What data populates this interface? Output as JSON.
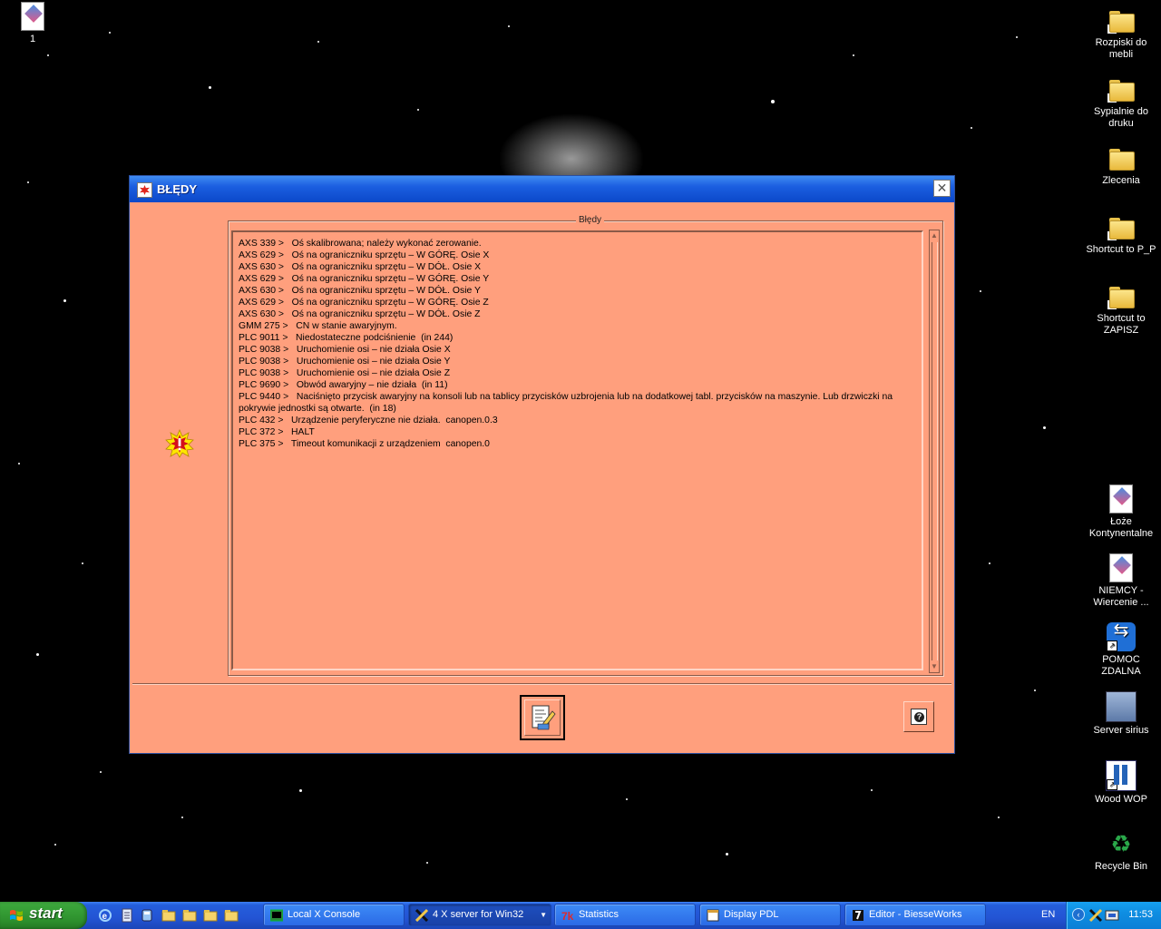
{
  "desktop": {
    "icons_left": [
      {
        "label": "1",
        "icon": "paint-document-icon"
      }
    ],
    "icons_right": [
      {
        "label": "Rozpiski do mebli",
        "icon": "folder-shortcut-icon"
      },
      {
        "label": "Sypialnie do druku",
        "icon": "folder-shortcut-icon"
      },
      {
        "label": "Zlecenia",
        "icon": "folder-icon"
      },
      {
        "label": "Shortcut to P_P",
        "icon": "folder-shortcut-icon"
      },
      {
        "label": "Shortcut to ZAPISZ",
        "icon": "folder-shortcut-icon"
      },
      {
        "label": "Łoże Kontynentalne",
        "icon": "paint-document-icon"
      },
      {
        "label": "NIEMCY - Wiercenie ...",
        "icon": "paint-document-icon"
      },
      {
        "label": "POMOC ZDALNA",
        "icon": "teamviewer-icon"
      },
      {
        "label": "Server sirius",
        "icon": "server-icon"
      },
      {
        "label": "Wood WOP",
        "icon": "wood-wop-icon"
      },
      {
        "label": "Recycle Bin",
        "icon": "recycle-bin-icon"
      }
    ]
  },
  "dialog": {
    "title": "BŁĘDY",
    "close_label": "✕",
    "group_label": "Błędy",
    "errors": [
      "AXS 339 >   Oś skalibrowana; należy wykonać zerowanie.",
      "AXS 629 >   Oś na ograniczniku sprzętu – W GÓRĘ. Osie X",
      "AXS 630 >   Oś na ograniczniku sprzętu – W DÓŁ. Osie X",
      "AXS 629 >   Oś na ograniczniku sprzętu – W GÓRĘ. Osie Y",
      "AXS 630 >   Oś na ograniczniku sprzętu – W DÓŁ. Osie Y",
      "AXS 629 >   Oś na ograniczniku sprzętu – W GÓRĘ. Osie Z",
      "AXS 630 >   Oś na ograniczniku sprzętu – W DÓŁ. Osie Z",
      "GMM 275 >   CN w stanie awaryjnym.",
      "PLC 9011 >   Niedostateczne podciśnienie  (in 244)",
      "PLC 9038 >   Uruchomienie osi – nie działa Osie X",
      "PLC 9038 >   Uruchomienie osi – nie działa Osie Y",
      "PLC 9038 >   Uruchomienie osi – nie działa Osie Z",
      "PLC 9690 >   Obwód awaryjny – nie działa  (in 11)",
      "PLC 9440 >   Naciśnięto przycisk awaryjny na konsoli lub na tablicy przycisków uzbrojenia lub na dodatkowej tabl. przycisków na maszynie. Lub drzwiczki na pokrywie jednostki są otwarte.  (in 18)",
      "PLC 432 >   Urządzenie peryferyczne nie działa.  canopen.0.3",
      "PLC 372 >   HALT",
      "PLC 375 >   Timeout komunikacji z urządzeniem  canopen.0"
    ]
  },
  "taskbar": {
    "start_label": "start",
    "quick_launch": [
      "ie-icon",
      "notepad-icon",
      "tool-icon",
      "folder-icon",
      "folder-icon",
      "folder-icon",
      "folder-icon"
    ],
    "tasks": [
      {
        "label": "Local X Console",
        "icon": "console-icon",
        "active": false
      },
      {
        "label": "4 X server for Win32",
        "icon": "x-server-icon",
        "active": true
      },
      {
        "label": "Statistics",
        "icon": "tk-icon",
        "active": false
      },
      {
        "label": "Display PDL",
        "icon": "window-icon",
        "active": false
      },
      {
        "label": "Editor - BiesseWorks",
        "icon": "biesse-icon",
        "active": false
      }
    ],
    "language": "EN",
    "clock": "11:53"
  }
}
